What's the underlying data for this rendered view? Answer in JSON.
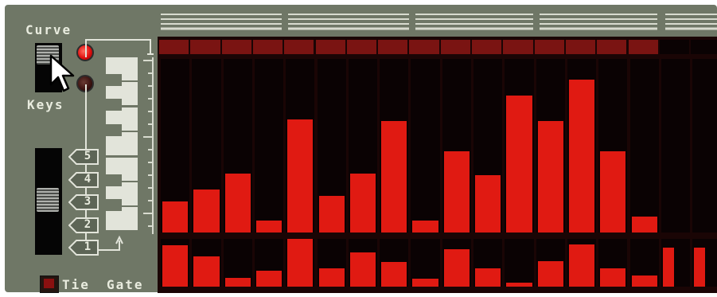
{
  "labels": {
    "curve": "Curve",
    "keys": "Keys",
    "tie": "Tie",
    "gate": "Gate"
  },
  "mode_switch": {
    "selected": "Curve"
  },
  "octave_buttons": [
    "5",
    "4",
    "3",
    "2",
    "1"
  ],
  "octave_selected": "3",
  "tie_enabled": false,
  "colors": {
    "panel": "#6f7766",
    "display_bg": "#0a0203",
    "bar": "#e01a12",
    "led_on": "#e01010"
  },
  "step_count": 16,
  "visible_steps": 18,
  "curve_values": [
    0.18,
    0.25,
    0.34,
    0.07,
    0.65,
    0.21,
    0.34,
    0.64,
    0.07,
    0.47,
    0.33,
    0.79,
    0.64,
    0.88,
    0.47,
    0.09,
    0,
    0
  ],
  "gate_values": [
    0.87,
    0.64,
    0.19,
    0.33,
    1.0,
    0.38,
    0.71,
    0.52,
    0.17,
    0.78,
    0.38,
    0.09,
    0.54,
    0.89,
    0.38,
    0.24,
    0.81,
    0.81
  ],
  "gate_tie": [
    false,
    false,
    false,
    false,
    false,
    false,
    false,
    false,
    false,
    false,
    false,
    false,
    false,
    false,
    false,
    false,
    false,
    false
  ]
}
